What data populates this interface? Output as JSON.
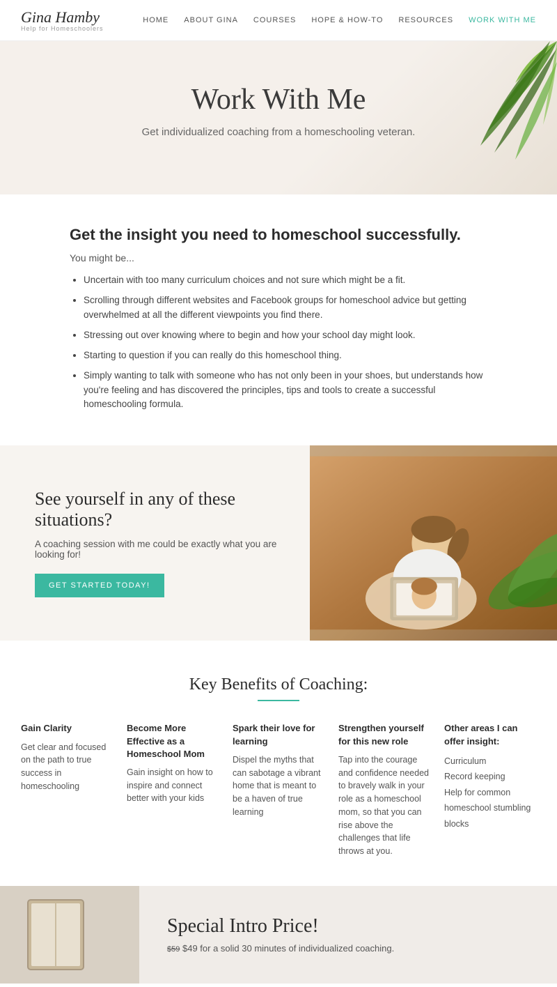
{
  "nav": {
    "logo_name": "Gina Hamby",
    "logo_sub": "Help for Homeschoolers",
    "links": [
      {
        "label": "HOME",
        "active": false
      },
      {
        "label": "ABOUT GINA",
        "active": false
      },
      {
        "label": "COURSES",
        "active": false
      },
      {
        "label": "HOPE & HOW-TO",
        "active": false
      },
      {
        "label": "RESOURCES",
        "active": false
      },
      {
        "label": "WORK WITH ME",
        "active": true
      }
    ]
  },
  "hero": {
    "title": "Work With Me",
    "subtitle": "Get individualized coaching from a homeschooling veteran."
  },
  "insight": {
    "heading": "Get the insight you need to homeschool successfully.",
    "you_might": "You might be...",
    "bullets": [
      "Uncertain with too many curriculum choices and not sure which might be a fit.",
      "Scrolling through different websites and Facebook groups for homeschool advice but getting overwhelmed at all the different viewpoints you find there.",
      "Stressing out over knowing where to begin and how your school day might look.",
      "Starting to question if you can really do this homeschool thing.",
      "Simply wanting to talk with someone who has not only been in your shoes, but understands how you're feeling and has discovered the principles, tips and tools to create a successful homeschooling formula."
    ]
  },
  "coaching": {
    "heading": "See yourself in any of these situations?",
    "description": "A coaching session with me could be exactly what you are looking for!",
    "button_label": "GET STARTED TODAY!"
  },
  "benefits": {
    "heading": "Key Benefits of Coaching:",
    "columns": [
      {
        "title": "Gain Clarity",
        "body": "Get clear and focused on the path to true success in homeschooling"
      },
      {
        "title": "Become More Effective as a Homeschool Mom",
        "body": "Gain insight on how to inspire and connect better with your kids"
      },
      {
        "title": "Spark their love for learning",
        "body": "Dispel the myths that can sabotage a vibrant home that is meant to be a haven of true learning"
      },
      {
        "title": "Strengthen yourself for this new role",
        "body": "Tap into the courage and confidence needed to bravely walk in your role as a homeschool mom, so that you can rise above the challenges that life throws at you."
      },
      {
        "title": "Other areas I can offer insight:",
        "list_items": [
          "Curriculum",
          "Record keeping",
          "Help for common homeschool stumbling blocks"
        ]
      }
    ]
  },
  "special_intro": {
    "heading": "Special Intro Price!",
    "price_old": "$59",
    "description": "$49 for a solid 30 minutes of individualized coaching."
  }
}
